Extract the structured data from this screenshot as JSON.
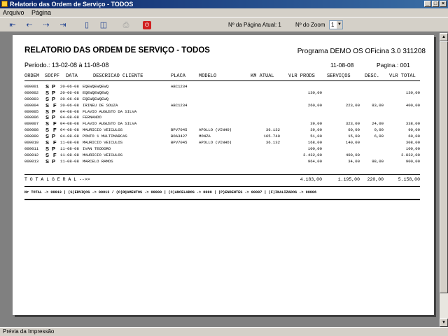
{
  "window": {
    "title": "Relatorio das Ordem de Serviço - TODOS"
  },
  "menu": {
    "items": [
      "Arquivo",
      "Página"
    ]
  },
  "toolbar": {
    "page_label": "Nº da Página Atual: 1",
    "zoom_label": "Nº do Zoom",
    "zoom_value": "1"
  },
  "report": {
    "title": "RELATORIO DAS ORDEM DE SERVIÇO  - TODOS",
    "program": "Programa DEMO OS OFicina 3.0 311208",
    "period": "Período.: 13-02-08 à 11-08-08",
    "date": "11-08-08",
    "page": "Pagina.: 001",
    "columns": {
      "ordem": "ORDEM",
      "socpf": "SOCPF",
      "data": "DATA",
      "descricao": "DESCRICAO CLIENTE",
      "placa": "PLACA",
      "modelo": "MODELO",
      "km": "KM ATUAL",
      "vlr_prods": "VLR PRODS",
      "servicos": "SERVIÇOS",
      "desc": "DESC.",
      "vlr_total": "VLR TOTAL"
    },
    "rows": [
      {
        "ordem": "000001",
        "s": "S",
        "c": "P",
        "data": "20-06-08",
        "cliente": "EQEWQEWQEWQ",
        "placa": "ABC1234",
        "modelo": "",
        "km": "",
        "vp": "",
        "sv": "",
        "ds": "",
        "vt": ""
      },
      {
        "ordem": "000002",
        "s": "S",
        "c": "P",
        "data": "20-06-08",
        "cliente": "EQEWQEWQEWQ",
        "placa": "",
        "modelo": "",
        "km": "",
        "vp": "130,00",
        "sv": "",
        "ds": "",
        "vt": "130,00"
      },
      {
        "ordem": "000003",
        "s": "S",
        "c": "P",
        "data": "20-06-08",
        "cliente": "EQEWQEWQEWQ",
        "placa": "",
        "modelo": "",
        "km": "",
        "vp": "",
        "sv": "",
        "ds": "",
        "vt": ""
      },
      {
        "ordem": "000004",
        "s": "S",
        "c": "F",
        "data": "20-06-08",
        "cliente": "IRINEU DE SOUZA",
        "placa": "ABC1234",
        "modelo": "",
        "km": "",
        "vp": "260,00",
        "sv": "223,00",
        "ds": "83,00",
        "vt": "400,00"
      },
      {
        "ordem": "000005",
        "s": "S",
        "c": "P",
        "data": "04-08-08",
        "cliente": "FLAVIO AUGUSTO DA SILVA",
        "placa": "",
        "modelo": "",
        "km": "",
        "vp": "",
        "sv": "",
        "ds": "",
        "vt": ""
      },
      {
        "ordem": "000006",
        "s": "S",
        "c": "P",
        "data": "04-08-08",
        "cliente": "FERNANDO",
        "placa": "",
        "modelo": "",
        "km": "",
        "vp": "",
        "sv": "",
        "ds": "",
        "vt": ""
      },
      {
        "ordem": "000007",
        "s": "S",
        "c": "F",
        "data": "04-08-08",
        "cliente": "FLAVIO AUGUSTO DA SILVA",
        "placa": "",
        "modelo": "",
        "km": "",
        "vp": "39,00",
        "sv": "323,00",
        "ds": "24,00",
        "vt": "338,00"
      },
      {
        "ordem": "000008",
        "s": "S",
        "c": "F",
        "data": "04-08-08",
        "cliente": "MAURICIO VEICULOS",
        "placa": "BPV7045",
        "modelo": "APOLLO (VINHO)",
        "km": "36.132",
        "vp": "39,00",
        "sv": "60,00",
        "ds": "9,00",
        "vt": "90,00"
      },
      {
        "ordem": "000009",
        "s": "S",
        "c": "P",
        "data": "04-08-08",
        "cliente": "PONTO 1 MULTIMARCAS",
        "placa": "BOA3427",
        "modelo": "MONZA",
        "km": "165.740",
        "vp": "51,00",
        "sv": "15,00",
        "ds": "6,00",
        "vt": "60,00"
      },
      {
        "ordem": "000010",
        "s": "S",
        "c": "F",
        "data": "11-08-08",
        "cliente": "MAURICIO VEICULOS",
        "placa": "BPV7045",
        "modelo": "APOLLO (VINHO)",
        "km": "36.132",
        "vp": "168,00",
        "sv": "140,00",
        "ds": "",
        "vt": "308,00"
      },
      {
        "ordem": "000011",
        "s": "S",
        "c": "P",
        "data": "11-08-08",
        "cliente": "IVAN TEODORO",
        "placa": "",
        "modelo": "",
        "km": "",
        "vp": "100,00",
        "sv": "",
        "ds": "",
        "vt": "100,00"
      },
      {
        "ordem": "000012",
        "s": "S",
        "c": "F",
        "data": "11-08-08",
        "cliente": "MAURICIO VEICULOS",
        "placa": "",
        "modelo": "",
        "km": "",
        "vp": "2.432,00",
        "sv": "400,00",
        "ds": "",
        "vt": "2.832,00"
      },
      {
        "ordem": "000013",
        "s": "S",
        "c": "P",
        "data": "11-08-08",
        "cliente": "MARCELO RAMOS",
        "placa": "",
        "modelo": "",
        "km": "",
        "vp": "964,00",
        "sv": "34,00",
        "ds": "98,00",
        "vt": "900,00"
      }
    ],
    "total": {
      "label": "T O T A L   G E R A L  -->>",
      "vp": "4.183,00",
      "sv": "1.195,00",
      "ds": "220,00",
      "vt": "5.158,00"
    },
    "summary": "Nr TOTAL -> 00013 | (S)ERVIÇOS -> 00013 / (O)RÇAMENTOS -> 00000 | (C)ANCELADOS -> 0000 | (P)ENDENTES -> 00007 | (F)INALIZADOS -> 00006"
  },
  "status": {
    "text": "Prévia da Impressão"
  }
}
